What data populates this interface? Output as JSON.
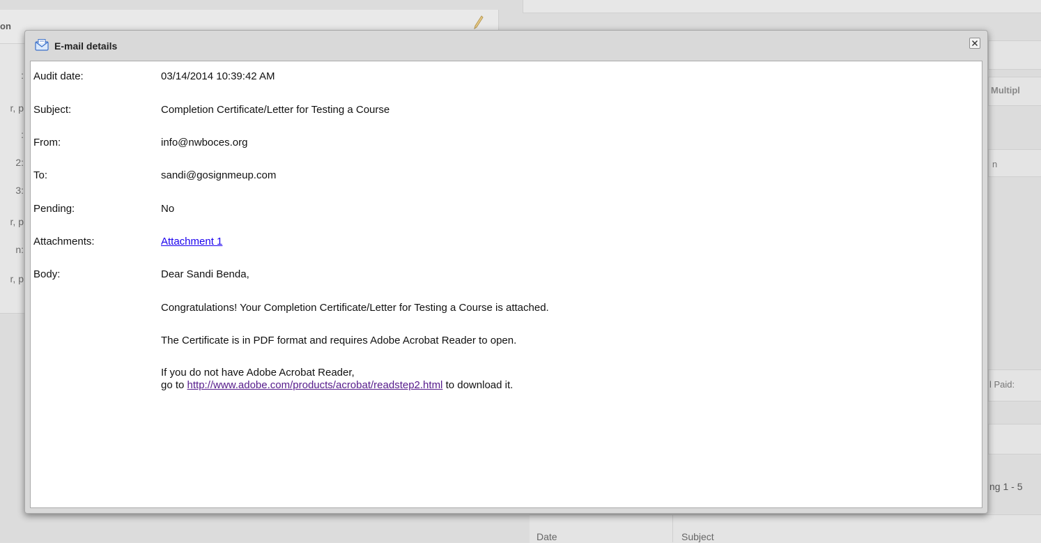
{
  "background": {
    "left_panel_title": "on",
    "left_labels": [
      ":",
      "r, p",
      ":",
      "2:",
      "3:",
      "r, p",
      "n:",
      "r, p"
    ],
    "right_texts": {
      "multiple": "Multipl",
      "n": "n",
      "total_paid": "l Paid:",
      "showing": "ng 1 - 5"
    },
    "grid_columns": [
      "Date",
      "Subject"
    ]
  },
  "modal": {
    "title": "E-mail details",
    "icon": "envelope-icon",
    "close_icon": "close-icon",
    "fields": {
      "audit_date": {
        "label": "Audit date:",
        "value": "03/14/2014 10:39:42 AM"
      },
      "subject": {
        "label": "Subject:",
        "value": "Completion Certificate/Letter for Testing a Course"
      },
      "from": {
        "label": "From:",
        "value": "info@nwboces.org"
      },
      "to": {
        "label": "To:",
        "value": "sandi@gosignmeup.com"
      },
      "pending": {
        "label": "Pending:",
        "value": "No"
      },
      "attachments": {
        "label": "Attachments:",
        "value": "Attachment 1"
      },
      "body": {
        "label": "Body:"
      }
    },
    "email_body": {
      "greeting": "Dear Sandi Benda,",
      "p1": "Congratulations! Your Completion Certificate/Letter for Testing a Course is attached.",
      "p2": "The Certificate is in PDF format and requires Adobe Acrobat Reader to open.",
      "p3_line1": "If you do not have Adobe Acrobat Reader,",
      "p3_line2_prefix": "go to ",
      "p3_link": "http://www.adobe.com/products/acrobat/readstep2.html",
      "p3_line2_suffix": " to download it."
    }
  },
  "colors": {
    "link": "#1a00ee",
    "visited_link": "#551a8b",
    "modal_chrome": "#d9d9d9"
  }
}
